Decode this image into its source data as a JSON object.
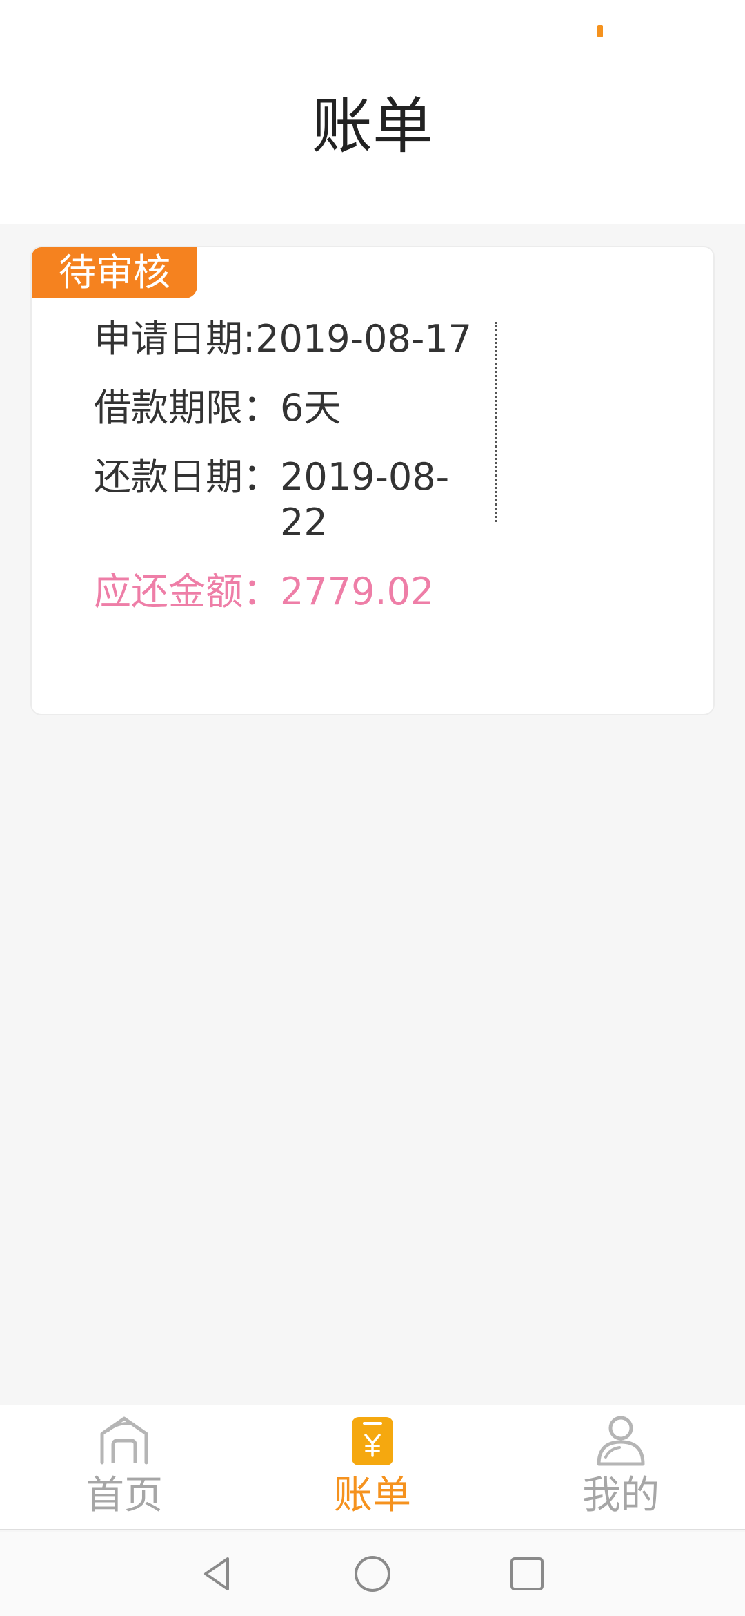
{
  "header": {
    "title": "账单"
  },
  "bill": {
    "status": "待审核",
    "apply_date_label": "申请日期:",
    "apply_date": "2019-08-17",
    "term_label": "借款期限：",
    "term": "6天",
    "repay_date_label": "还款日期：",
    "repay_date": "2019-08-22",
    "amount_label": "应还金额：",
    "amount": "2779.02"
  },
  "tabs": [
    {
      "label": "首页",
      "icon": "home-icon",
      "active": false
    },
    {
      "label": "账单",
      "icon": "bill-icon",
      "active": true
    },
    {
      "label": "我的",
      "icon": "person-icon",
      "active": false
    }
  ],
  "nav": {
    "back_icon": "back-triangle-icon",
    "home_icon": "home-circle-icon",
    "recents_icon": "recents-square-icon"
  },
  "colors": {
    "accent": "#f5921e",
    "badge": "#f5821f",
    "amount": "#ee7ea7",
    "inactive": "#a6a6a6"
  }
}
